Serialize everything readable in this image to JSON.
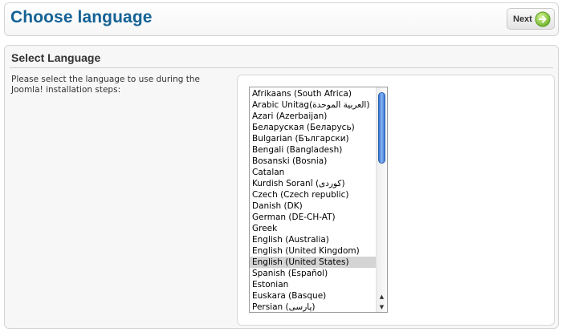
{
  "header": {
    "title": "Choose language",
    "next_label": "Next"
  },
  "panel": {
    "title": "Select Language",
    "instructions": "Please select the language to use during the Joomla! installation steps:"
  },
  "languages": {
    "items": [
      "Afrikaans (South Africa)",
      "Arabic Unitag(العربية الموحدة)",
      "Azari (Azerbaijan)",
      "Беларуская (Беларусь)",
      "Bulgarian (Български)",
      "Bengali (Bangladesh)",
      "Bosanski (Bosnia)",
      "Catalan",
      "Kurdish Soranî (کوردی)",
      "Czech (Czech republic)",
      "Danish (DK)",
      "German (DE-CH-AT)",
      "Greek",
      "English (Australia)",
      "English (United Kingdom)",
      "English (United States)",
      "Spanish (Español)",
      "Estonian",
      "Euskara (Basque)",
      "Persian (پارسی)"
    ],
    "selected": "English (United States)"
  },
  "colors": {
    "title": "#146295",
    "selected_bg": "#d4d4d4",
    "scroll_thumb": "#3c7bd6",
    "next_icon": "#8fcf3c"
  }
}
